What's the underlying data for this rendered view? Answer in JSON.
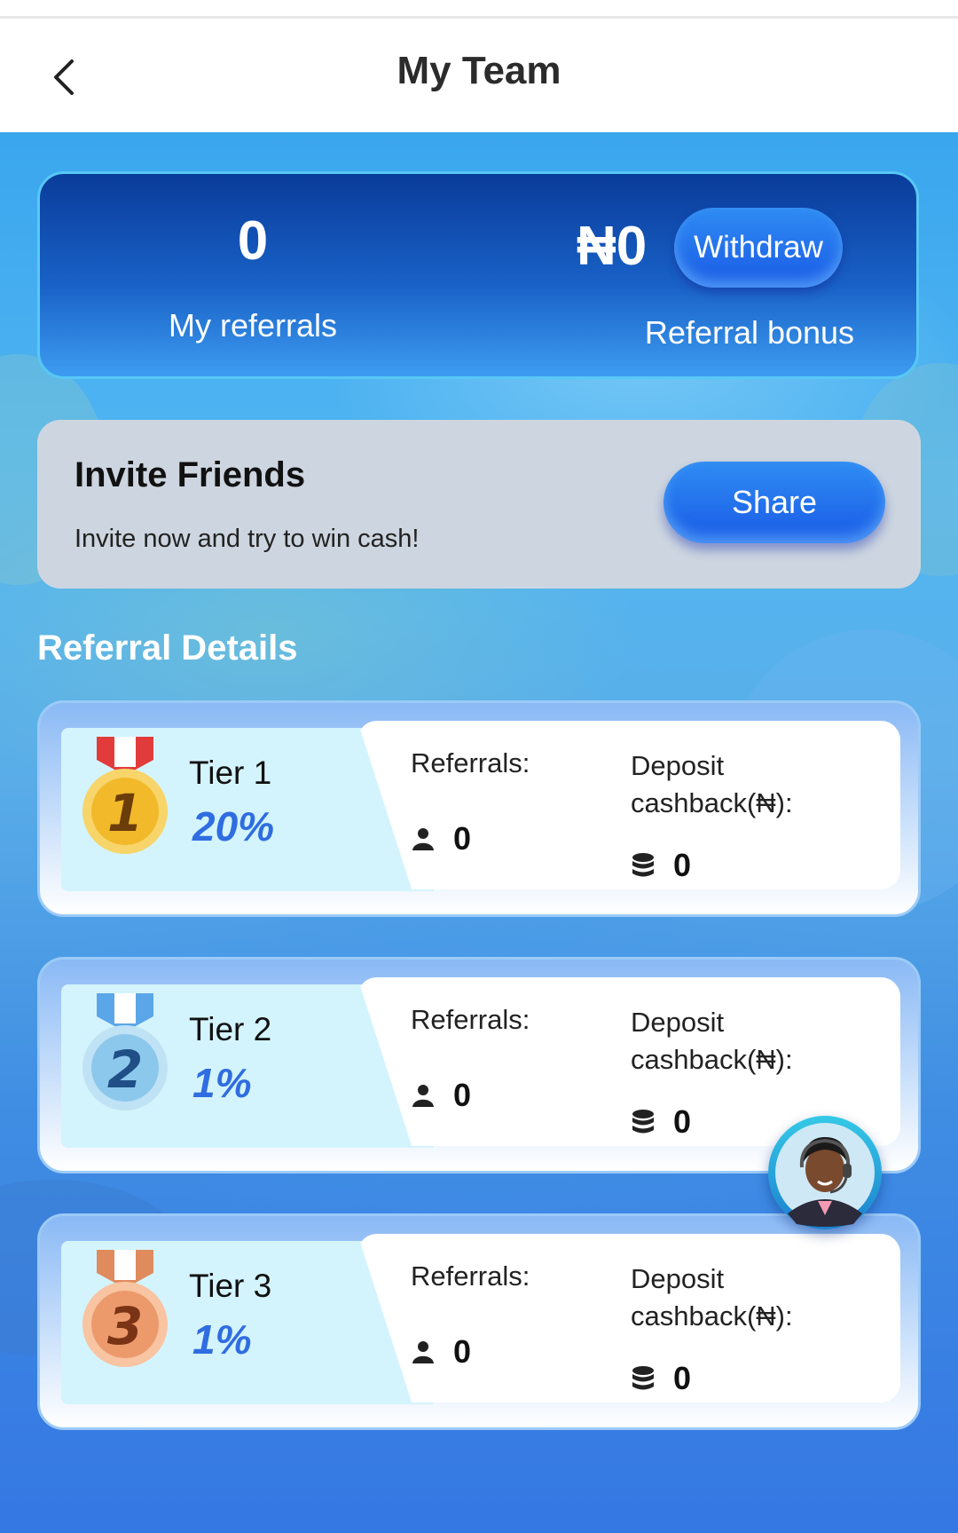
{
  "header": {
    "title": "My Team"
  },
  "stats": {
    "referrals_value": "0",
    "referrals_label": "My referrals",
    "bonus_value": "₦0",
    "bonus_label": "Referral bonus",
    "withdraw_label": "Withdraw"
  },
  "invite": {
    "title": "Invite Friends",
    "subtitle": "Invite now and try to win cash!",
    "share_label": "Share"
  },
  "section_title": "Referral Details",
  "tiers": [
    {
      "name": "Tier 1",
      "percent": "20%",
      "medal": "gold-medal-1",
      "referrals_label": "Referrals:",
      "referrals_value": "0",
      "cashback_label": "Deposit cashback(₦):",
      "cashback_value": "0"
    },
    {
      "name": "Tier 2",
      "percent": "1%",
      "medal": "silver-medal-2",
      "referrals_label": "Referrals:",
      "referrals_value": "0",
      "cashback_label": "Deposit cashback(₦):",
      "cashback_value": "0"
    },
    {
      "name": "Tier 3",
      "percent": "1%",
      "medal": "bronze-medal-3",
      "referrals_label": "Referrals:",
      "referrals_value": "0",
      "cashback_label": "Deposit cashback(₦):",
      "cashback_value": "0"
    }
  ],
  "colors": {
    "accent_blue": "#2f6de0",
    "button_blue": "#1a5ae6",
    "card_dark_blue": "#0a3c9a",
    "invite_bg": "#cdd6e0",
    "tier_left_bg": "#d4f4fd"
  },
  "icons": {
    "back": "chevron-left-icon",
    "person": "person-icon",
    "coins": "coin-stack-icon",
    "support": "customer-support-avatar"
  }
}
